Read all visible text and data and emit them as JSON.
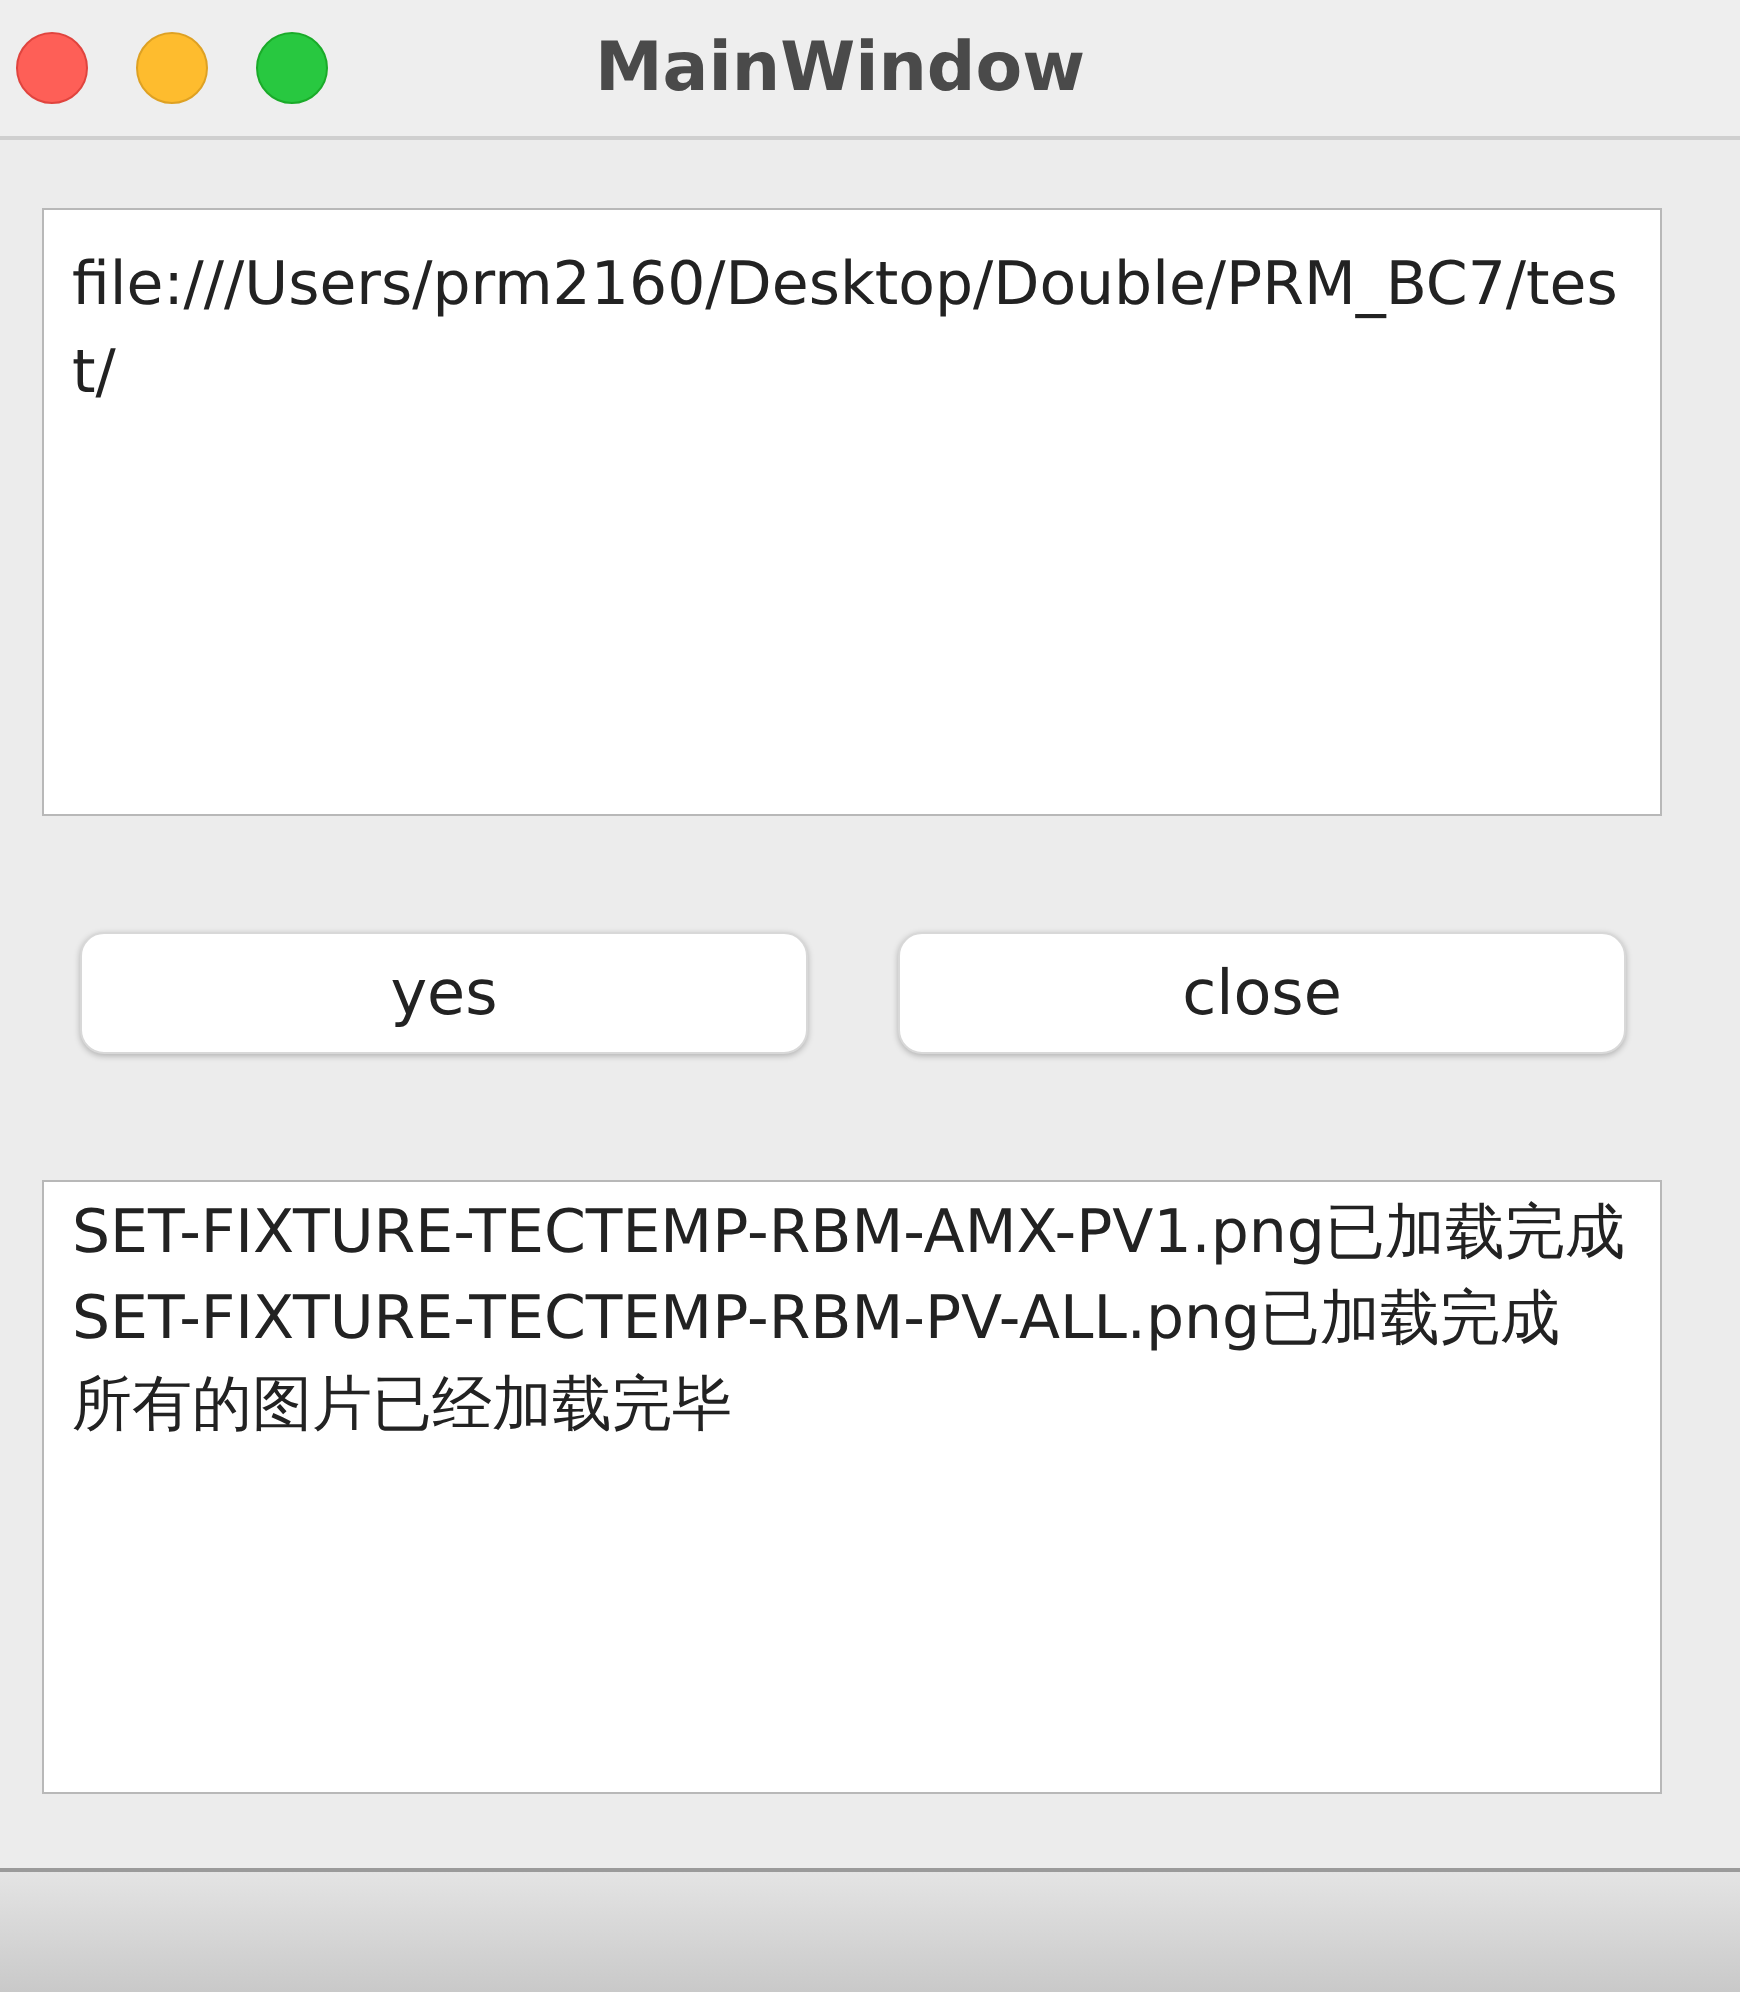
{
  "window": {
    "title": "MainWindow"
  },
  "path_field": {
    "value": "file:///Users/prm2160/Desktop/Double/PRM_BC7/test/"
  },
  "buttons": [
    {
      "label": "yes"
    },
    {
      "label": "close"
    }
  ],
  "log": [
    "SET-FIXTURE-TECTEMP-RBM-AMX-PV1.png已加载完成",
    "SET-FIXTURE-TECTEMP-RBM-PV-ALL.png已加载完成",
    "所有的图片已经加载完毕"
  ]
}
